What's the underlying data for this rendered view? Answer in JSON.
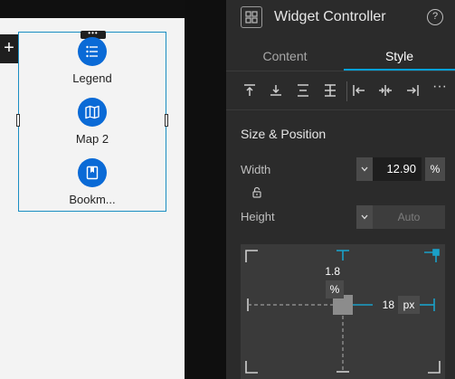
{
  "canvas": {
    "add_button": "+",
    "selection_dots": "•••",
    "widgets": [
      {
        "label": "Legend",
        "icon": "list-icon"
      },
      {
        "label": "Map 2",
        "icon": "map-icon"
      },
      {
        "label": "Bookm...",
        "icon": "bookmark-icon"
      }
    ]
  },
  "panel": {
    "title": "Widget Controller",
    "help": "?",
    "tabs": [
      {
        "label": "Content",
        "active": false
      },
      {
        "label": "Style",
        "active": true
      }
    ],
    "align_more": "···",
    "section_title": "Size & Position",
    "width": {
      "label": "Width",
      "value": "12.90",
      "unit": "%"
    },
    "height": {
      "label": "Height",
      "value": "Auto"
    },
    "position": {
      "top_value": "1.8",
      "top_unit": "%",
      "right_value": "18",
      "right_unit": "px"
    }
  },
  "colors": {
    "accent": "#00a0d8",
    "widget_icon": "#0a6ad6",
    "panel_bg": "#2b2b2b",
    "selection_border": "#1a8ec2"
  }
}
